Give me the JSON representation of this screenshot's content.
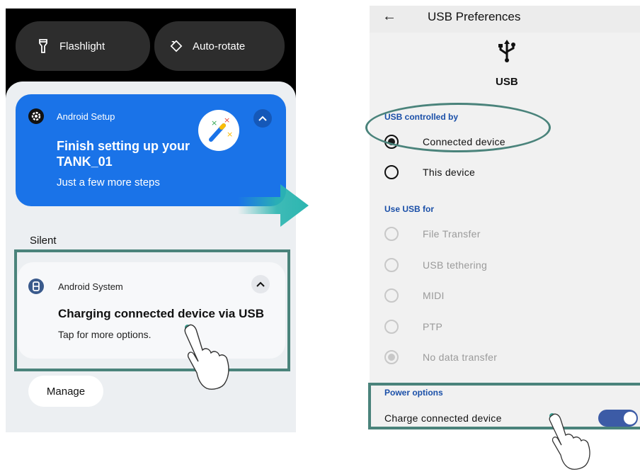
{
  "left": {
    "quick_settings": [
      {
        "label": "Flashlight",
        "icon": "flashlight-icon"
      },
      {
        "label": "Auto-rotate",
        "icon": "auto-rotate-icon"
      }
    ],
    "setup_notification": {
      "app": "Android Setup",
      "title": "Finish setting up your TANK_01",
      "subtitle": "Just a few more steps",
      "accent": "#1a73e8"
    },
    "silent_label": "Silent",
    "system_notification": {
      "app": "Android System",
      "title": "Charging connected device via USB",
      "subtitle": "Tap for more options."
    },
    "manage_label": "Manage"
  },
  "right": {
    "header": {
      "back_icon": "back-arrow-icon",
      "title": "USB Preferences"
    },
    "usb_label": "USB",
    "controlled_by": {
      "label": "USB controlled by",
      "options": [
        {
          "label": "Connected device",
          "selected": true
        },
        {
          "label": "This device",
          "selected": false
        }
      ]
    },
    "use_for": {
      "label": "Use USB for",
      "options": [
        {
          "label": "File Transfer",
          "selected": false,
          "disabled": true
        },
        {
          "label": "USB tethering",
          "selected": false,
          "disabled": true
        },
        {
          "label": "MIDI",
          "selected": false,
          "disabled": true
        },
        {
          "label": "PTP",
          "selected": false,
          "disabled": true
        },
        {
          "label": "No data transfer",
          "selected": true,
          "disabled": true
        }
      ]
    },
    "power_options": {
      "label": "Power options",
      "charge_label": "Charge connected device",
      "charge_enabled": true
    }
  },
  "colors": {
    "highlight": "#4a837b",
    "arrow": "#2bb5b0",
    "toggle": "#3c5ba6",
    "section_label": "#1a4fa8"
  }
}
